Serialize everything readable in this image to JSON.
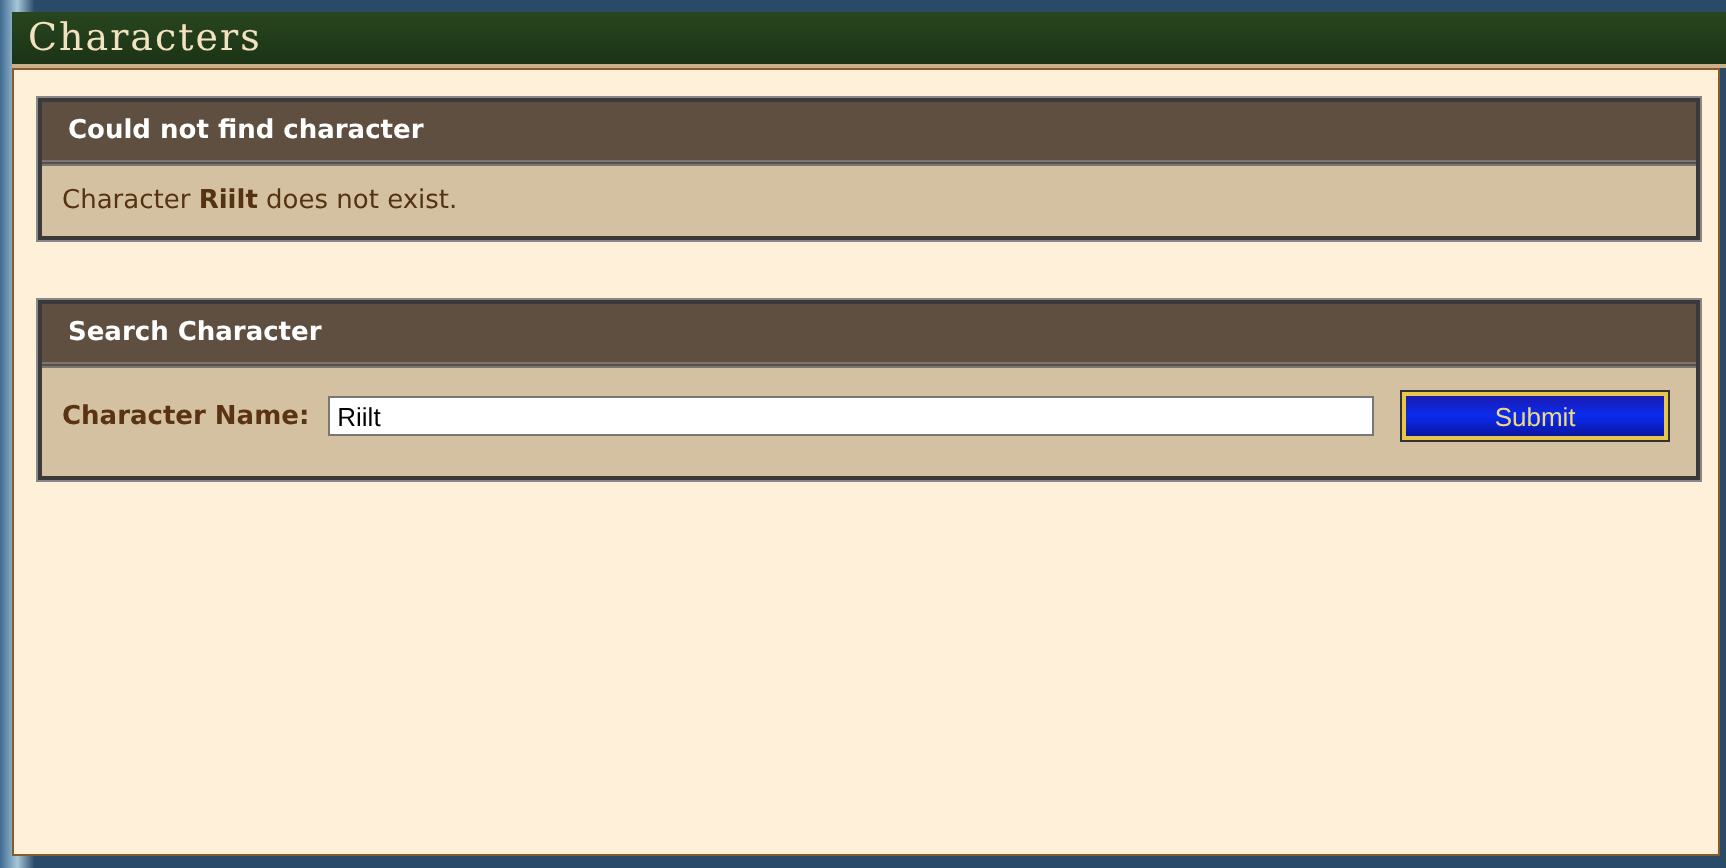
{
  "window": {
    "title": "Characters"
  },
  "error_panel": {
    "title": "Could not find character",
    "message": "Character **Riilt** does not exist."
  },
  "search_panel": {
    "title": "Search Character",
    "label": "Character Name:",
    "value": "Riilt",
    "button": "Submit"
  }
}
